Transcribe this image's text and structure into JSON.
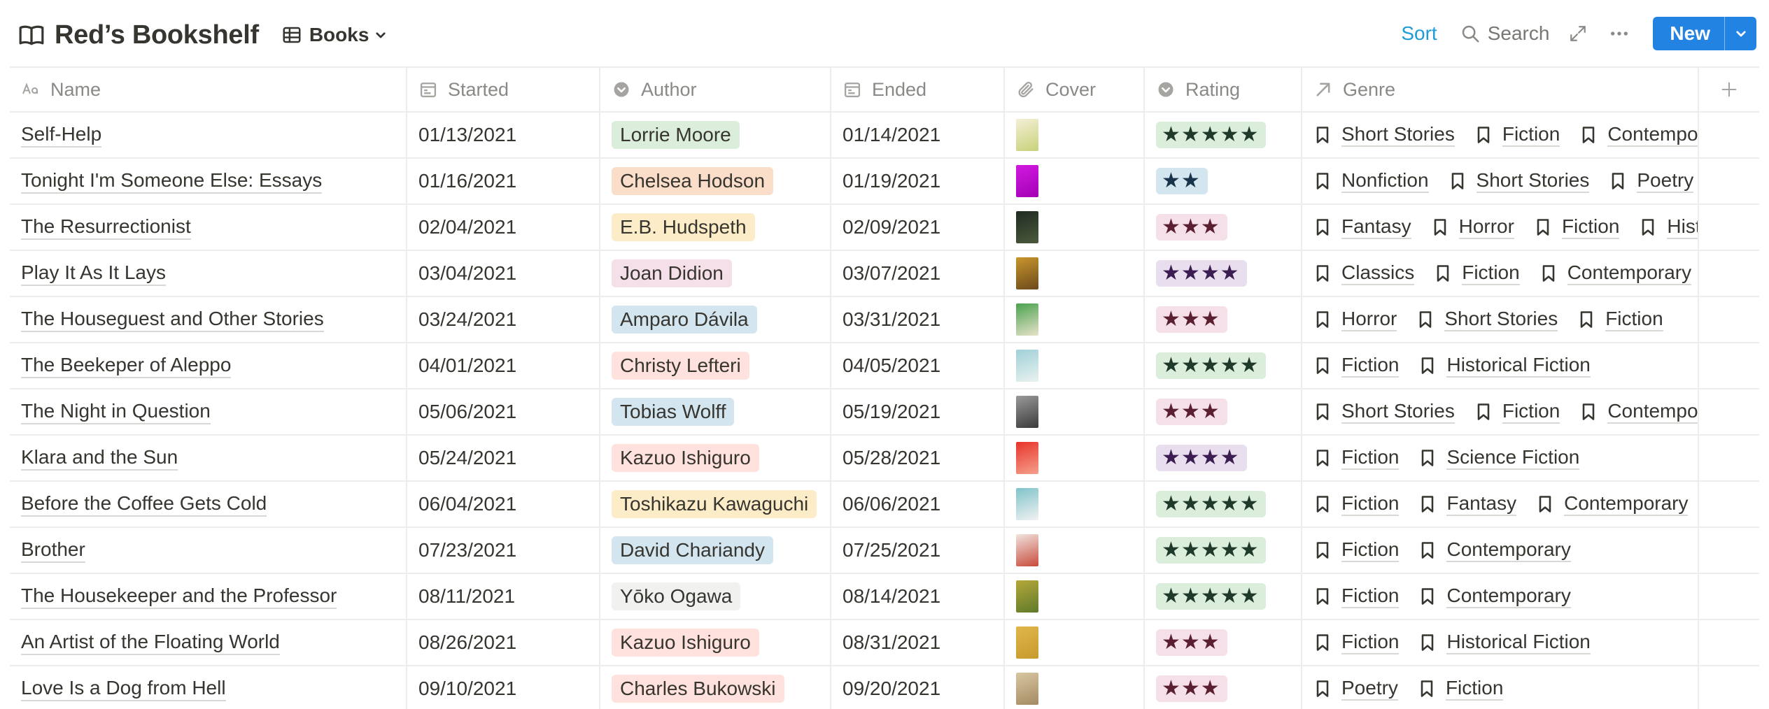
{
  "page": {
    "title": "Red’s Bookshelf"
  },
  "view": {
    "label": "Books"
  },
  "toolbar": {
    "sort_label": "Sort",
    "search_label": "Search",
    "new_label": "New"
  },
  "columns": {
    "name": "Name",
    "started": "Started",
    "author": "Author",
    "ended": "Ended",
    "cover": "Cover",
    "rating": "Rating",
    "genre": "Genre"
  },
  "colors": {
    "accent": "#2383e2",
    "tag_green": "#dbeddb",
    "tag_orange": "#fadec9",
    "tag_yellow": "#fdecc8",
    "tag_pink": "#f5e0e9",
    "tag_blue": "#d3e5ef",
    "tag_red": "#ffe2dd",
    "tag_gray": "#f1f1ef",
    "tag_purple": "#e8deee",
    "star_green": "#1f3a2a",
    "star_red": "#5a1f30",
    "star_purple": "#3b1d52",
    "star_blue": "#18334a"
  },
  "rows": [
    {
      "name": "Self-Help",
      "started": "01/13/2021",
      "author": "Lorrie Moore",
      "author_color": "#dbeddb",
      "ended": "01/14/2021",
      "cover": [
        "#f3efd6",
        "#c8d27a"
      ],
      "stars": "★★★★★",
      "rating_bg": "#dbeddb",
      "rating_fg": "#1f3a2a",
      "genres": [
        "Short Stories",
        "Fiction",
        "Contemporary"
      ]
    },
    {
      "name": "Tonight I'm Someone Else: Essays",
      "started": "01/16/2021",
      "author": "Chelsea Hodson",
      "author_color": "#fadec9",
      "ended": "01/19/2021",
      "cover": [
        "#d21ae0",
        "#a300b5"
      ],
      "stars": "★★",
      "rating_bg": "#d3e5ef",
      "rating_fg": "#18334a",
      "genres": [
        "Nonfiction",
        "Short Stories",
        "Poetry"
      ]
    },
    {
      "name": "The Resurrectionist",
      "started": "02/04/2021",
      "author": "E.B. Hudspeth",
      "author_color": "#fdecc8",
      "ended": "02/09/2021",
      "cover": [
        "#1f2a22",
        "#4b5a3c"
      ],
      "stars": "★★★",
      "rating_bg": "#f5e0e9",
      "rating_fg": "#5a1f30",
      "genres": [
        "Fantasy",
        "Horror",
        "Fiction",
        "Historical Fiction"
      ]
    },
    {
      "name": "Play It As It Lays",
      "started": "03/04/2021",
      "author": "Joan Didion",
      "author_color": "#f5e0e9",
      "ended": "03/07/2021",
      "cover": [
        "#c9962e",
        "#6b4a1a"
      ],
      "stars": "★★★★",
      "rating_bg": "#e8deee",
      "rating_fg": "#3b1d52",
      "genres": [
        "Classics",
        "Fiction",
        "Contemporary"
      ]
    },
    {
      "name": "The Houseguest and Other Stories",
      "started": "03/24/2021",
      "author": "Amparo Dávila",
      "author_color": "#d3e5ef",
      "ended": "03/31/2021",
      "cover": [
        "#4aa24f",
        "#e8e2c9"
      ],
      "stars": "★★★",
      "rating_bg": "#f5e0e9",
      "rating_fg": "#5a1f30",
      "genres": [
        "Horror",
        "Short Stories",
        "Fiction"
      ]
    },
    {
      "name": "The Beekeper of Aleppo",
      "started": "04/01/2021",
      "author": "Christy Lefteri",
      "author_color": "#ffe2dd",
      "ended": "04/05/2021",
      "cover": [
        "#9fd0d8",
        "#e9f2ef"
      ],
      "stars": "★★★★★",
      "rating_bg": "#dbeddb",
      "rating_fg": "#1f3a2a",
      "genres": [
        "Fiction",
        "Historical Fiction"
      ]
    },
    {
      "name": "The Night in Question",
      "started": "05/06/2021",
      "author": "Tobias Wolff",
      "author_color": "#d3e5ef",
      "ended": "05/19/2021",
      "cover": [
        "#9a9a9a",
        "#3a3a3a"
      ],
      "stars": "★★★",
      "rating_bg": "#f5e0e9",
      "rating_fg": "#5a1f30",
      "genres": [
        "Short Stories",
        "Fiction",
        "Contemporary"
      ]
    },
    {
      "name": "Klara and the Sun",
      "started": "05/24/2021",
      "author": "Kazuo Ishiguro",
      "author_color": "#ffe2dd",
      "ended": "05/28/2021",
      "cover": [
        "#e8332a",
        "#f5a08c"
      ],
      "stars": "★★★★",
      "rating_bg": "#e8deee",
      "rating_fg": "#3b1d52",
      "genres": [
        "Fiction",
        "Science Fiction"
      ]
    },
    {
      "name": "Before the Coffee Gets Cold",
      "started": "06/04/2021",
      "author": "Toshikazu Kawaguchi",
      "author_color": "#fdecc8",
      "ended": "06/06/2021",
      "cover": [
        "#7fc3c9",
        "#f2f2f2"
      ],
      "stars": "★★★★★",
      "rating_bg": "#dbeddb",
      "rating_fg": "#1f3a2a",
      "genres": [
        "Fiction",
        "Fantasy",
        "Contemporary"
      ]
    },
    {
      "name": "Brother",
      "started": "07/23/2021",
      "author": "David Chariandy",
      "author_color": "#d3e5ef",
      "ended": "07/25/2021",
      "cover": [
        "#f1e4e0",
        "#c84a3a"
      ],
      "stars": "★★★★★",
      "rating_bg": "#dbeddb",
      "rating_fg": "#1f3a2a",
      "genres": [
        "Fiction",
        "Contemporary"
      ]
    },
    {
      "name": "The Housekeeper and the Professor",
      "started": "08/11/2021",
      "author": "Yōko Ogawa",
      "author_color": "#f1f1ef",
      "ended": "08/14/2021",
      "cover": [
        "#b5a83a",
        "#5f7a2a"
      ],
      "stars": "★★★★★",
      "rating_bg": "#dbeddb",
      "rating_fg": "#1f3a2a",
      "genres": [
        "Fiction",
        "Contemporary"
      ]
    },
    {
      "name": "An Artist of the Floating World",
      "started": "08/26/2021",
      "author": "Kazuo Ishiguro",
      "author_color": "#ffe2dd",
      "ended": "08/31/2021",
      "cover": [
        "#e0b64a",
        "#c99a2e"
      ],
      "stars": "★★★",
      "rating_bg": "#f5e0e9",
      "rating_fg": "#5a1f30",
      "genres": [
        "Fiction",
        "Historical Fiction"
      ]
    },
    {
      "name": "Love Is a Dog from Hell",
      "started": "09/10/2021",
      "author": "Charles Bukowski",
      "author_color": "#ffe2dd",
      "ended": "09/20/2021",
      "cover": [
        "#d8c7a3",
        "#a48a62"
      ],
      "stars": "★★★",
      "rating_bg": "#f5e0e9",
      "rating_fg": "#5a1f30",
      "genres": [
        "Poetry",
        "Fiction"
      ]
    }
  ]
}
